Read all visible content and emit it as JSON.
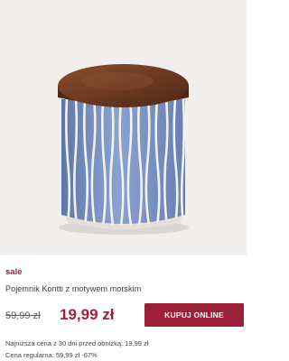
{
  "product": {
    "image_icon": "ceramic-jar-with-wooden-lid",
    "sale_label": "sale",
    "name": "Pojemnik Kontti z motywem morskim",
    "old_price": "59,99 zł",
    "new_price": "19,99 zł",
    "buy_label": "KUPUJ ONLINE",
    "lowest_price_note": "Najniższa cena z 30 dni przed obniżką: 19,99 zł",
    "regular_price_note": "Cena regularna: 59,99 zł -67%"
  },
  "colors": {
    "accent": "#a3203a",
    "button": "#9c2038",
    "image_background": "#f0efee",
    "jar_blue": "#7f97c4",
    "lid_wood": "#6b3a23"
  }
}
